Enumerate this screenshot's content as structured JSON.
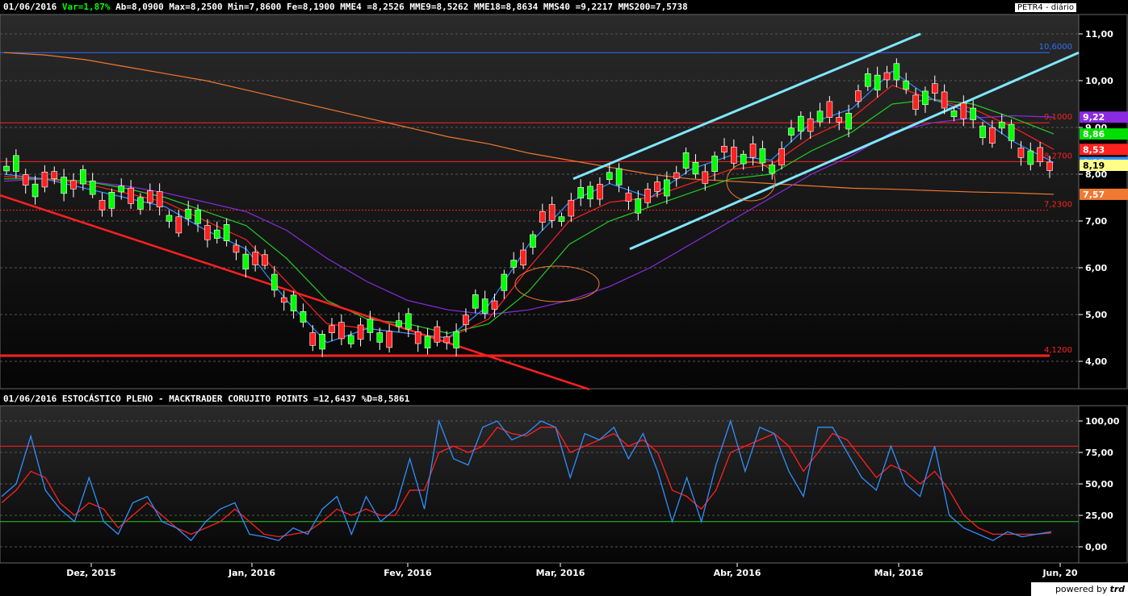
{
  "header": {
    "date": "01/06/2016",
    "var_label": "Var=",
    "var_value": "1,87%",
    "rest": "Ab=8,0900  Max=8,2500  Min=7,8600  Fe=8,1900  MME4 =8,2526  MME9=8,5262  MME18=8,8634  MMS40 =9,2217  MMS200=7,5738"
  },
  "symbol": "PETR4 - diário",
  "lower_header": "01/06/2016  ESTOCÁSTICO PLENO - MACKTRADER CORUJITO POINTS =12,6437  %D=8,5861",
  "powered": {
    "text": "powered by",
    "brand": "trd"
  },
  "colors": {
    "up": "#00ff00",
    "down": "#ff2020",
    "mme4": "#2f8fff",
    "mme9": "#ff2020",
    "mme18": "#22cc22",
    "mms40": "#8a2be2",
    "mms200": "#f07830",
    "channel": "#7fe7ff",
    "stoch_k": "#2f8fff",
    "stoch_d": "#ff2020"
  },
  "chart_data": [
    {
      "type": "candlestick",
      "title": "PETR4 - diário",
      "ylim": [
        3.5,
        11.5
      ],
      "y_ticks": [
        "11,00",
        "10,00",
        "9,00",
        "8,00",
        "7,00",
        "6,00",
        "5,00",
        "4,00"
      ],
      "x_ticks": [
        "Dez, 2015",
        "Jan, 2016",
        "Fev, 2016",
        "Mar, 2016",
        "Abr, 2016",
        "Mai, 2016",
        "Jun, 20"
      ],
      "levels": [
        {
          "value": 10.6,
          "label": "10,6000",
          "color": "#2f6fff"
        },
        {
          "value": 9.1,
          "label": "9,1000",
          "color": "#ff2020"
        },
        {
          "value": 8.27,
          "label": "8,2700",
          "color": "#ff2020"
        },
        {
          "value": 7.23,
          "label": "7,2300",
          "color": "#ff2020"
        },
        {
          "value": 4.12,
          "label": "4,1200",
          "color": "#ff2020"
        }
      ],
      "last_values": [
        {
          "label": "9,22",
          "value": 9.22,
          "bg": "#8a2be2",
          "fg": "#fff"
        },
        {
          "label": "8,86",
          "value": 8.86,
          "bg": "#00e000",
          "fg": "#fff"
        },
        {
          "label": "8,53",
          "value": 8.53,
          "bg": "#ff2020",
          "fg": "#fff"
        },
        {
          "label": "8,25",
          "value": 8.25,
          "bg": "#2f8fff",
          "fg": "#fff"
        },
        {
          "label": "8,19",
          "value": 8.19,
          "bg": "#ffff88",
          "fg": "#000"
        },
        {
          "label": "7,57",
          "value": 7.57,
          "bg": "#f07830",
          "fg": "#fff"
        }
      ],
      "series": [
        {
          "name": "MME4",
          "values": [
            8.0,
            7.9,
            7.7,
            7.5,
            7.3,
            6.8,
            6.4,
            5.3,
            4.4,
            4.7,
            4.6,
            4.5,
            5.2,
            6.5,
            7.4,
            7.8,
            7.5,
            8.1,
            8.4,
            8.3,
            9.1,
            9.4,
            10.2,
            9.6,
            9.3,
            8.7,
            8.25
          ]
        },
        {
          "name": "MME9",
          "values": [
            7.95,
            7.9,
            7.8,
            7.6,
            7.4,
            7.0,
            6.6,
            5.7,
            4.8,
            4.7,
            4.6,
            4.5,
            4.9,
            6.0,
            7.0,
            7.4,
            7.5,
            7.8,
            8.1,
            8.2,
            8.8,
            9.2,
            9.9,
            9.6,
            9.4,
            9.0,
            8.53
          ]
        },
        {
          "name": "MME18",
          "values": [
            7.9,
            7.9,
            7.85,
            7.7,
            7.5,
            7.2,
            6.9,
            6.2,
            5.3,
            4.9,
            4.8,
            4.6,
            4.8,
            5.5,
            6.5,
            7.0,
            7.3,
            7.6,
            7.9,
            8.0,
            8.5,
            8.9,
            9.5,
            9.6,
            9.5,
            9.2,
            8.86
          ]
        },
        {
          "name": "MMS40",
          "values": [
            7.85,
            7.9,
            7.85,
            7.75,
            7.6,
            7.4,
            7.2,
            6.8,
            6.2,
            5.7,
            5.3,
            5.1,
            5.0,
            5.1,
            5.3,
            5.6,
            6.0,
            6.5,
            7.0,
            7.5,
            8.0,
            8.4,
            8.9,
            9.1,
            9.2,
            9.25,
            9.22
          ]
        },
        {
          "name": "MMS200",
          "values": [
            10.6,
            10.55,
            10.45,
            10.3,
            10.15,
            10.0,
            9.8,
            9.6,
            9.4,
            9.2,
            9.0,
            8.8,
            8.65,
            8.45,
            8.3,
            8.15,
            8.0,
            7.9,
            7.85,
            7.8,
            7.75,
            7.7,
            7.68,
            7.65,
            7.62,
            7.6,
            7.57
          ]
        }
      ]
    },
    {
      "type": "line",
      "title": "ESTOCÁSTICO PLENO - MACKTRADER CORUJITO POINTS",
      "ylim": [
        -10,
        105
      ],
      "y_ticks": [
        "100,00",
        "75,00",
        "50,00",
        "25,00",
        "0,00"
      ],
      "levels": [
        80,
        20
      ],
      "series": [
        {
          "name": "CORUJITO POINTS",
          "values": [
            40,
            50,
            88,
            45,
            30,
            20,
            55,
            20,
            10,
            35,
            40,
            20,
            15,
            5,
            20,
            30,
            35,
            10,
            8,
            5,
            15,
            10,
            30,
            40,
            10,
            40,
            20,
            30,
            70,
            30,
            100,
            70,
            65,
            95,
            100,
            85,
            90,
            100,
            95,
            55,
            90,
            85,
            95,
            70,
            90,
            60,
            20,
            55,
            20,
            65,
            100,
            60,
            95,
            90,
            60,
            40,
            95,
            95,
            75,
            55,
            45,
            80,
            50,
            40,
            80,
            25,
            15,
            10,
            5,
            12,
            8,
            10,
            12
          ]
        },
        {
          "name": "%D",
          "values": [
            35,
            45,
            60,
            55,
            35,
            25,
            35,
            30,
            15,
            25,
            35,
            25,
            15,
            10,
            15,
            20,
            30,
            20,
            10,
            8,
            10,
            12,
            20,
            30,
            25,
            30,
            25,
            25,
            45,
            45,
            75,
            80,
            75,
            80,
            95,
            90,
            88,
            95,
            95,
            75,
            80,
            85,
            90,
            80,
            85,
            75,
            45,
            40,
            30,
            45,
            75,
            80,
            85,
            90,
            80,
            60,
            75,
            90,
            85,
            70,
            55,
            65,
            60,
            50,
            60,
            45,
            25,
            15,
            10,
            10,
            10,
            10,
            11
          ]
        }
      ]
    }
  ]
}
